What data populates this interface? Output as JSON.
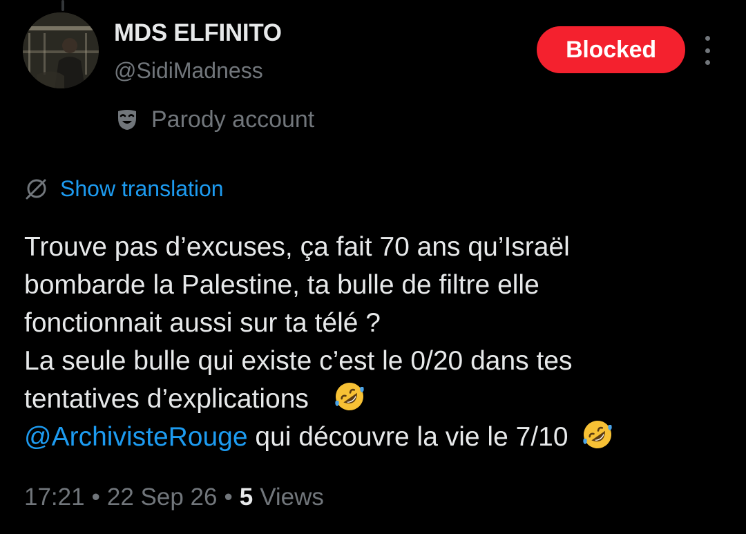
{
  "post": {
    "author": {
      "display_name": "MDS ELFINITO",
      "handle": "@SidiMadness",
      "avatar": "profile-photo"
    },
    "relationship_button": {
      "label": "Blocked",
      "color": "#f4212e"
    },
    "more_menu_icon": "more-vertical-icon",
    "account_label": {
      "icon": "parody-mask-icon",
      "text": "Parody account"
    },
    "translation": {
      "icon": "globe-icon",
      "label": "Show translation"
    },
    "body": {
      "line1": "Trouve pas d’excuses, ça fait 70 ans qu’Israël",
      "line2": "bombarde la Palestine, ta bulle de filtre elle",
      "line3": "fonctionnait aussi sur ta télé ?",
      "line4": "La seule bulle qui existe c’est le 0/20 dans tes",
      "line5_text": "tentatives d’explications",
      "line5_emoji": "rolling-on-floor-laughing-emoji",
      "mention": "@ArchivisteRouge",
      "line6_text": " qui découvre la vie le 7/10",
      "line6_emoji": "rolling-on-floor-laughing-emoji"
    },
    "meta": {
      "time": "17:21",
      "date": "22 Sep 26",
      "separator": "•",
      "views_count": "5",
      "views_label": "Views"
    }
  },
  "colors": {
    "background": "#000000",
    "primary_text": "#e7e9ea",
    "secondary_text": "#71767b",
    "link": "#1d9bf0",
    "blocked": "#f4212e"
  }
}
